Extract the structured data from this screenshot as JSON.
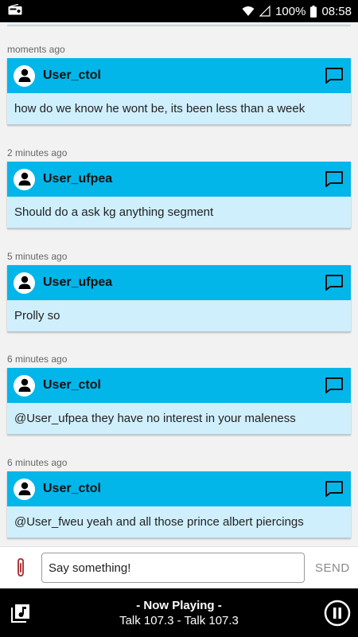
{
  "status": {
    "battery": "100%",
    "time": "08:58"
  },
  "messages": [
    {
      "time": "moments ago",
      "user": "User_ctol",
      "text": "how do we know he wont be, its been less than a week"
    },
    {
      "time": "2 minutes ago",
      "user": "User_ufpea",
      "text": "Should do a ask kg anything segment"
    },
    {
      "time": "5 minutes ago",
      "user": "User_ufpea",
      "text": "Prolly so"
    },
    {
      "time": "6 minutes ago",
      "user": "User_ctol",
      "text": "@User_ufpea they have no interest in your maleness"
    },
    {
      "time": "6 minutes ago",
      "user": "User_ctol",
      "text": "@User_fweu yeah and all those prince albert piercings"
    }
  ],
  "composer": {
    "placeholder": "Say something!",
    "value": "Say something!",
    "send_label": "SEND"
  },
  "player": {
    "label": "- Now Playing -",
    "track": "Talk 107.3 - Talk 107.3"
  },
  "colors": {
    "header": "#02b6ea",
    "body": "#cfeffc",
    "attach": "#b03a3a"
  }
}
